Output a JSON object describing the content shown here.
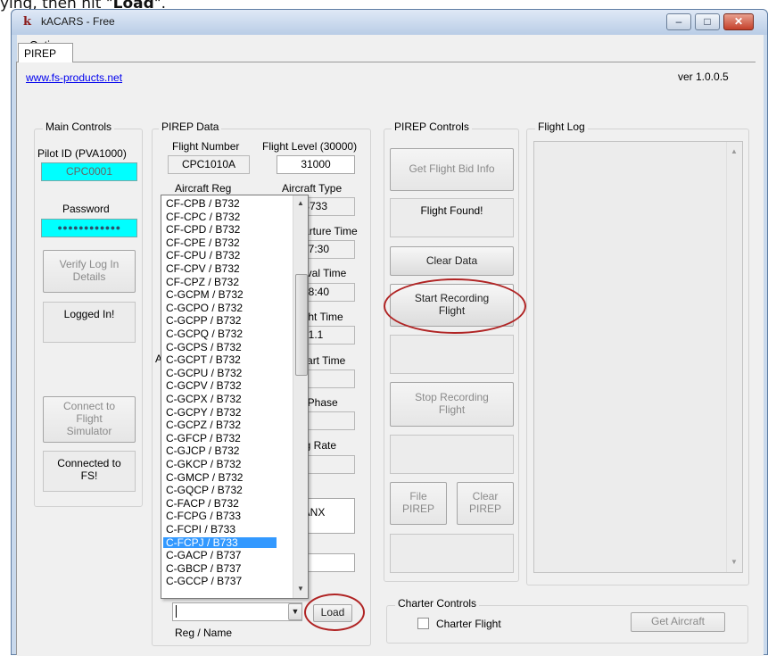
{
  "caption": {
    "prefix": "ying, then hit \"",
    "bold": "Load",
    "suffix": "\"."
  },
  "window": {
    "title": "kACARS - Free",
    "min": "–",
    "max": "□",
    "close": "✕"
  },
  "menu": {
    "options": "Options"
  },
  "tab": {
    "label": "PIREP"
  },
  "header": {
    "link": "www.fs-products.net",
    "version": "ver 1.0.0.5"
  },
  "main_controls": {
    "title": "Main Controls",
    "pilot_id_label": "Pilot ID (PVA1000)",
    "pilot_id_value": "CPC0001",
    "password_label": "Password",
    "password_value": "●●●●●●●●●●●●",
    "verify_button": "Verify Log In Details",
    "login_status": "Logged In!",
    "connect_button": "Connect to Flight Simulator",
    "connect_status": "Connected to FS!"
  },
  "pirep_data": {
    "title": "PIREP Data",
    "flight_number_label": "Flight Number",
    "flight_number_value": "CPC1010A",
    "flight_level_label": "Flight Level (30000)",
    "flight_level_value": "31000",
    "aircraft_reg_label": "Aircraft Reg",
    "aircraft_type_label": "Aircraft Type",
    "aircraft_type_value": "B733",
    "frag_de": "De",
    "dep_time_label": "Departure Time",
    "dep_time_value": "17:30",
    "arr_time_label": "Arrival Time",
    "arr_time_value": "18:40",
    "flight_time_label": "Flight Time",
    "flight_time_value": "01.1",
    "frag_ac": "Ac",
    "depart_time_label": "Depart Time",
    "flight_phase_label": "t Phase",
    "frag_i": "I",
    "landing_rate_label": "ng Rate",
    "route_fragment": "RANX",
    "reg_name_label": "Reg / Name",
    "load_button": "Load",
    "combo_arrow": "▼"
  },
  "aircraft_list": {
    "items": [
      "CF-CPB / B732",
      "CF-CPC / B732",
      "CF-CPD / B732",
      "CF-CPE / B732",
      "CF-CPU / B732",
      "CF-CPV / B732",
      "CF-CPZ / B732",
      "C-GCPM / B732",
      "C-GCPO / B732",
      "C-GCPP / B732",
      "C-GCPQ / B732",
      "C-GCPS / B732",
      "C-GCPT / B732",
      "C-GCPU / B732",
      "C-GCPV / B732",
      "C-GCPX / B732",
      "C-GCPY / B732",
      "C-GCPZ / B732",
      "C-GFCP / B732",
      "C-GJCP / B732",
      "C-GKCP / B732",
      "C-GMCP / B732",
      "C-GQCP / B732",
      "C-FACP / B732",
      "C-FCPG / B733",
      "C-FCPI / B733",
      "C-FCPJ / B733",
      "C-GACP / B737",
      "C-GBCP / B737",
      "C-GCCP / B737"
    ],
    "selected": "C-FCPJ / B733"
  },
  "pirep_controls": {
    "title": "PIREP Controls",
    "get_bid_button": "Get Flight Bid Info",
    "bid_status": "Flight Found!",
    "clear_data_button": "Clear Data",
    "start_button": "Start Recording Flight",
    "stop_button": "Stop Recording Flight",
    "file_button": "File PIREP",
    "clear_pirep_button": "Clear PIREP"
  },
  "flight_log": {
    "title": "Flight Log"
  },
  "charter": {
    "title": "Charter Controls",
    "checkbox_label": "Charter Flight",
    "get_aircraft_button": "Get Aircraft"
  },
  "colors": {
    "accent_cyan": "#00ffff",
    "highlight_ellipse": "#b02424",
    "selection": "#3399ff"
  }
}
